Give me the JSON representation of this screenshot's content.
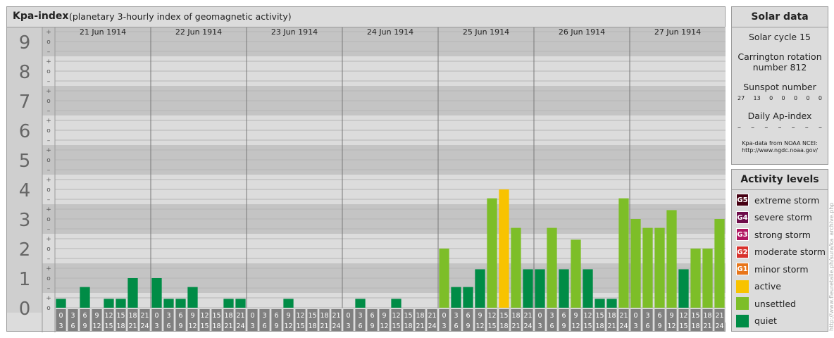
{
  "header": {
    "title": "Kpa-index",
    "subtitle": "(planetary 3-hourly index of geomagnetic activity)"
  },
  "chart_data": {
    "type": "bar",
    "title": "Kpa-index",
    "subtitle": "(planetary 3-hourly index of geomagnetic activity)",
    "ylim": [
      0,
      9
    ],
    "y_ticks": [
      "0",
      "1",
      "2",
      "3",
      "4",
      "5",
      "6",
      "7",
      "8",
      "9"
    ],
    "minor_ticks": [
      "o",
      "+",
      "–"
    ],
    "days": [
      "21 Jun 1914",
      "22 Jun 1914",
      "23 Jun 1914",
      "24 Jun 1914",
      "25 Jun 1914",
      "26 Jun 1914",
      "27 Jun 1914"
    ],
    "hour_start_labels": [
      "0",
      "3",
      "6",
      "9",
      "12",
      "15",
      "18",
      "21"
    ],
    "hour_end_labels": [
      "3",
      "6",
      "9",
      "12",
      "15",
      "18",
      "21",
      "24"
    ],
    "values": [
      [
        0.3,
        0.0,
        0.7,
        0.0,
        0.3,
        0.3,
        1.0,
        0.0
      ],
      [
        1.0,
        0.3,
        0.3,
        0.7,
        0.0,
        0.0,
        0.3,
        0.3
      ],
      [
        0.0,
        0.0,
        0.0,
        0.3,
        0.0,
        0.0,
        0.0,
        0.0
      ],
      [
        0.0,
        0.3,
        0.0,
        0.0,
        0.3,
        0.0,
        0.0,
        0.0
      ],
      [
        2.0,
        0.7,
        0.7,
        1.3,
        3.7,
        4.0,
        2.7,
        1.3
      ],
      [
        1.3,
        2.7,
        1.3,
        2.3,
        1.3,
        0.3,
        0.3,
        3.7
      ],
      [
        3.0,
        2.7,
        2.7,
        3.3,
        1.3,
        2.0,
        2.0,
        3.0
      ]
    ],
    "grid": true
  },
  "colors": {
    "quiet": "#008c46",
    "unsettled": "#7dbe28",
    "active": "#f8c300",
    "minor": "#e8751a",
    "moderate": "#d8322d",
    "strong": "#b01560",
    "severe": "#6e0c4a",
    "extreme": "#460012"
  },
  "solar": {
    "title": "Solar data",
    "cycle": "Solar cycle 15",
    "carrington_1": "Carrington rotation",
    "carrington_2": "number 812",
    "sunspot_label": "Sunspot number",
    "sunspots": [
      "27",
      "13",
      "0",
      "0",
      "0",
      "0",
      "0"
    ],
    "ap_label": "Daily Ap-index",
    "ap_values": [
      "–",
      "–",
      "–",
      "–",
      "–",
      "–",
      "–"
    ],
    "credit_1": "Kpa-data from NOAA NCEI:",
    "credit_2": "http://www.ngdc.noaa.gov/"
  },
  "activity": {
    "title": "Activity levels",
    "levels": [
      {
        "badge": "G5",
        "label": "extreme storm",
        "color": "#460012"
      },
      {
        "badge": "G4",
        "label": "severe storm",
        "color": "#6e0c4a"
      },
      {
        "badge": "G3",
        "label": "strong storm",
        "color": "#b01560"
      },
      {
        "badge": "G2",
        "label": "moderate storm",
        "color": "#d8322d"
      },
      {
        "badge": "G1",
        "label": "minor storm",
        "color": "#e8751a"
      },
      {
        "badge": "",
        "label": "active",
        "color": "#f8c300"
      },
      {
        "badge": "",
        "label": "unsettled",
        "color": "#7dbe28"
      },
      {
        "badge": "",
        "label": "quiet",
        "color": "#008c46"
      }
    ]
  },
  "side_credit": "http://www.fleuretalie.ph/sura/ka_archive.php"
}
